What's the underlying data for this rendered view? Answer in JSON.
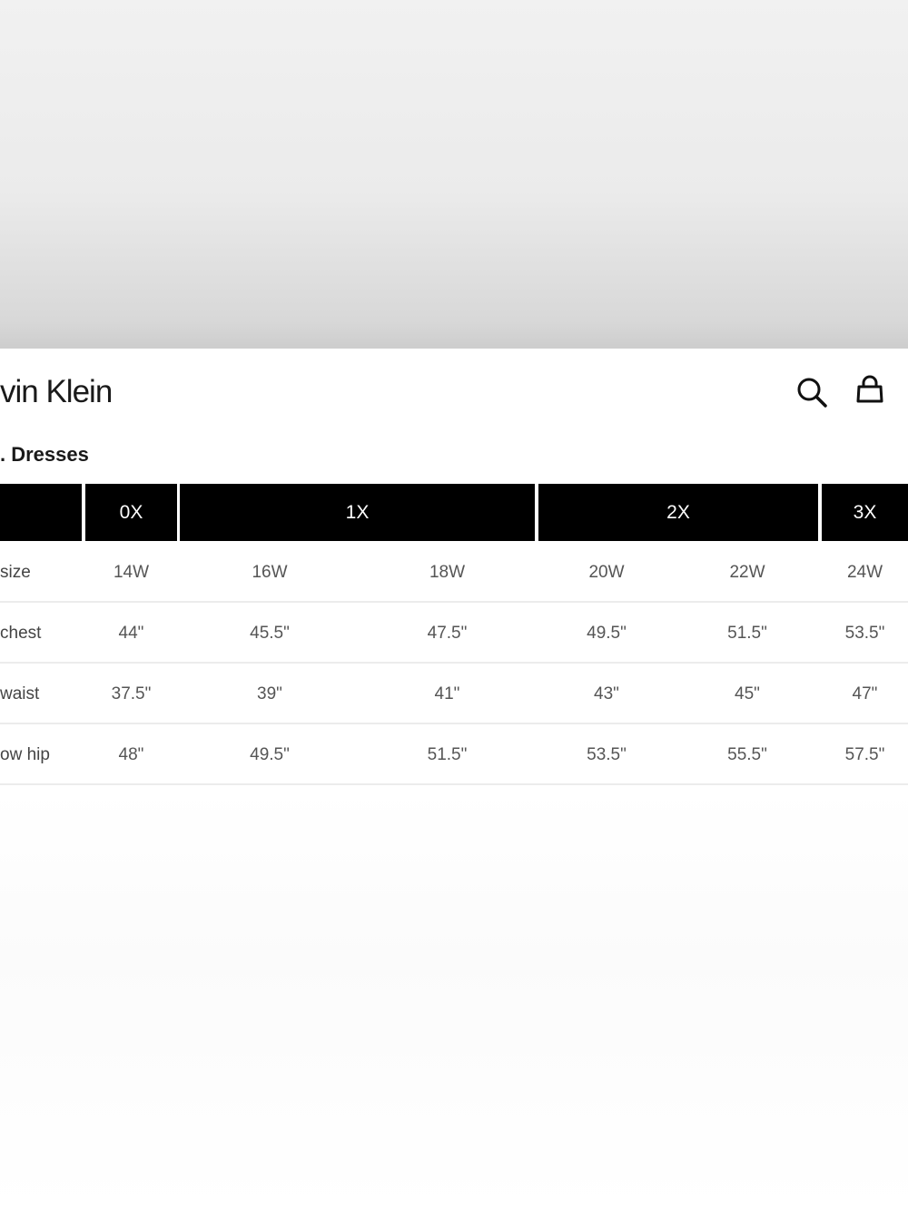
{
  "header": {
    "brand": "vin Klein",
    "section_title": ". Dresses",
    "icons": [
      "search-icon",
      "bag-icon"
    ]
  },
  "table": {
    "size_groups": [
      "0X",
      "1X",
      "2X",
      "3X"
    ],
    "rows": [
      {
        "label": " size",
        "values": [
          "14W",
          "16W",
          "18W",
          "20W",
          "22W",
          "24W"
        ]
      },
      {
        "label": "chest",
        "values": [
          "44\"",
          "45.5\"",
          "47.5\"",
          "49.5\"",
          "51.5\"",
          "53.5\""
        ]
      },
      {
        "label": "waist",
        "values": [
          "37.5\"",
          "39\"",
          "41\"",
          "43\"",
          "45\"",
          "47\""
        ]
      },
      {
        "label": "ow hip",
        "values": [
          "48\"",
          "49.5\"",
          "51.5\"",
          "53.5\"",
          "55.5\"",
          "57.5\""
        ]
      }
    ]
  },
  "colors": {
    "header_bg": "#000000",
    "header_text": "#ffffff",
    "row_line": "#ececec"
  }
}
